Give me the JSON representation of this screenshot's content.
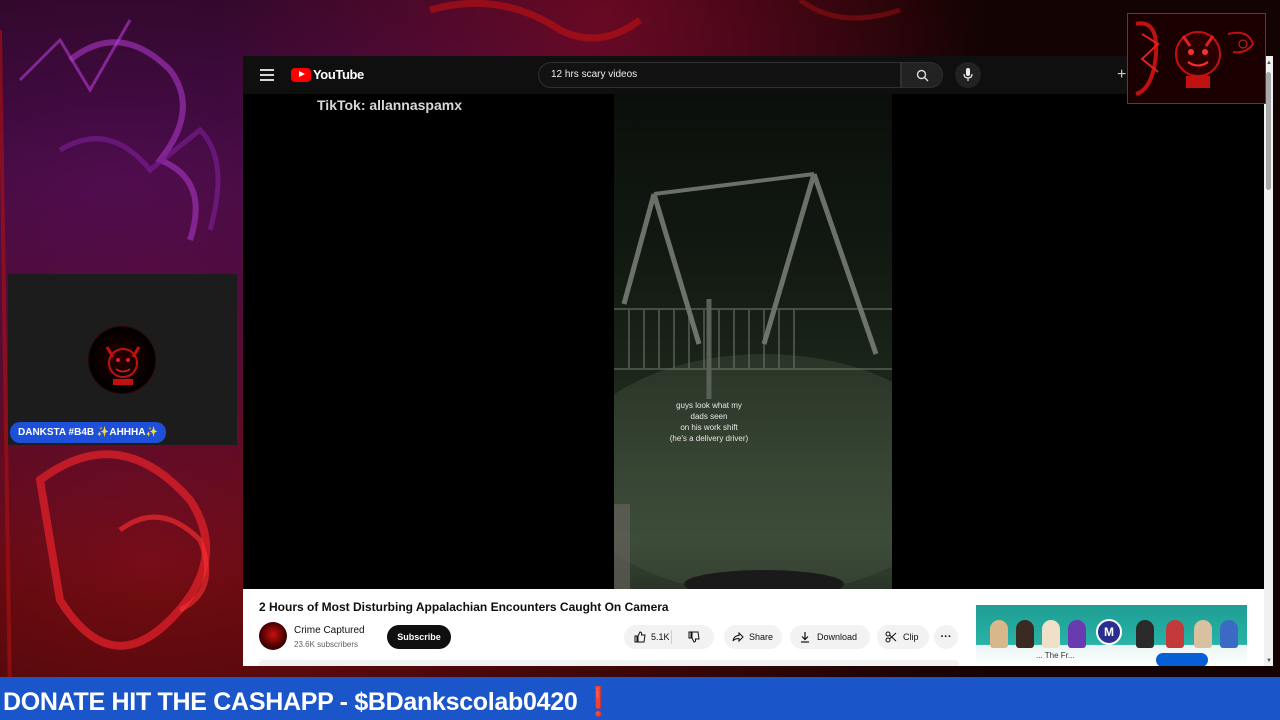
{
  "youtube": {
    "logo_text": "YouTube",
    "search_query": "12 hrs scary videos",
    "create_symbol": "+"
  },
  "video": {
    "watermark": "TikTok: allannaspamx",
    "caption_lines": [
      "guys look what my",
      "dads seen",
      "on his work shift",
      "(he's a delivery driver)"
    ],
    "title": "2 Hours of Most Disturbing Appalachian Encounters Caught On Camera",
    "channel_name": "Crime Captured",
    "subscribers": "23.6K subscribers",
    "subscribe_label": "Subscribe",
    "likes": "5.1K",
    "share_label": "Share",
    "download_label": "Download",
    "clip_label": "Clip",
    "more_label": "···"
  },
  "ad": {
    "text": "... The Fr...",
    "logo_letter": "M"
  },
  "stream": {
    "streamer_name": "DANKSTA #B4B ✨AHHHA✨",
    "ticker_text": "DONATE HIT THE CASHAPP - $BDankscolab0420",
    "ticker_emoji": "❗"
  },
  "colors": {
    "ticker_bg": "#1a55c9",
    "name_badge_bg": "#1d4fd8",
    "yt_red": "#ff0000",
    "overlay_red": "#c01010"
  }
}
